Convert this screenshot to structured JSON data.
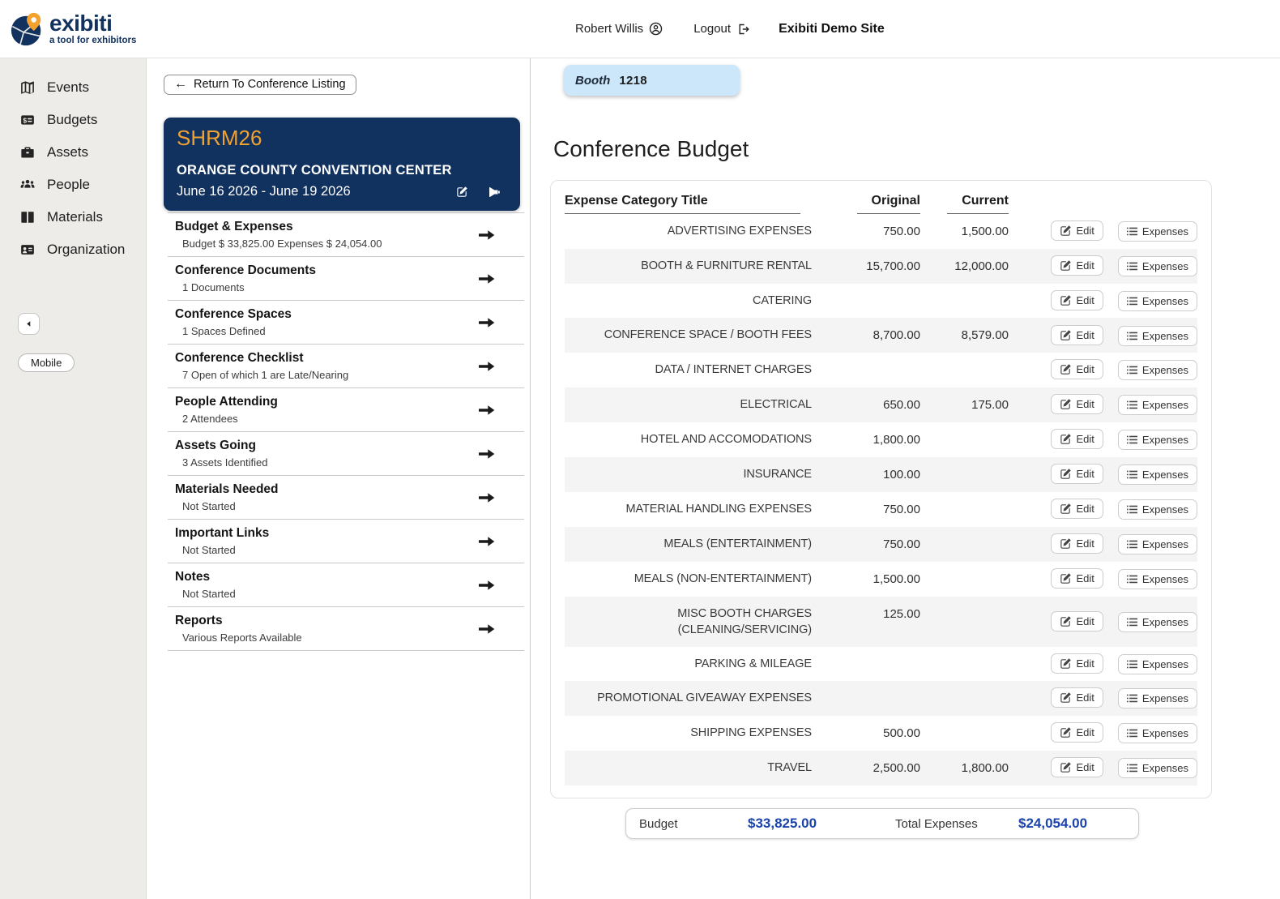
{
  "colors": {
    "navy": "#11315f",
    "orange": "#f0a231",
    "booth": "#cde7fa",
    "money": "#1a43ad",
    "altrow": "#f4f4f4"
  },
  "header": {
    "brand": "exibiti",
    "tagline": "a tool for exhibitors",
    "logo_icon": "logo-globe-icon",
    "user_name": "Robert Willis",
    "user_icon": "person-circle-icon",
    "logout_label": "Logout",
    "logout_icon": "logout-icon",
    "site_name": "Exibiti Demo Site"
  },
  "sidebar": {
    "items": [
      {
        "label": "Events",
        "icon": "map-icon"
      },
      {
        "label": "Budgets",
        "icon": "money-card-icon"
      },
      {
        "label": "Assets",
        "icon": "briefcase-icon"
      },
      {
        "label": "People",
        "icon": "people-icon"
      },
      {
        "label": "Materials",
        "icon": "book-icon"
      },
      {
        "label": "Organization",
        "icon": "id-card-icon"
      }
    ],
    "collapse_icon": "triangle-left-icon",
    "mobile_label": "Mobile"
  },
  "left_panel": {
    "return_button": "Return To Conference Listing",
    "conference": {
      "code": "SHRM26",
      "venue": "ORANGE COUNTY CONVENTION CENTER",
      "dates": "June 16 2026 - June 19 2026",
      "icons": [
        "edit-icon",
        "megaphone-icon"
      ]
    },
    "sections": [
      {
        "title": "Budget & Expenses",
        "subtitle": "Budget $ 33,825.00 Expenses $ 24,054.00"
      },
      {
        "title": "Conference Documents",
        "subtitle": "1 Documents"
      },
      {
        "title": "Conference Spaces",
        "subtitle": "1 Spaces Defined"
      },
      {
        "title": "Conference Checklist",
        "subtitle": "7 Open of which 1 are Late/Nearing"
      },
      {
        "title": "People Attending",
        "subtitle": "2 Attendees"
      },
      {
        "title": "Assets Going",
        "subtitle": "3 Assets Identified"
      },
      {
        "title": "Materials Needed",
        "subtitle": "Not Started"
      },
      {
        "title": "Important Links",
        "subtitle": "Not Started"
      },
      {
        "title": "Notes",
        "subtitle": "Not Started"
      },
      {
        "title": "Reports",
        "subtitle": "Various Reports Available"
      }
    ],
    "section_arrow_icon": "arrow-right-icon"
  },
  "main": {
    "booth_label": "Booth",
    "booth_number": "1218",
    "title": "Conference Budget",
    "table": {
      "headers": [
        "Expense Category Title",
        "Original",
        "Current"
      ],
      "edit_label": "Edit",
      "edit_icon": "edit-icon",
      "expenses_label": "Expenses",
      "expenses_icon": "list-icon",
      "rows": [
        {
          "category": "ADVERTISING EXPENSES",
          "original": "750.00",
          "current": "1,500.00"
        },
        {
          "category": "BOOTH & FURNITURE RENTAL",
          "original": "15,700.00",
          "current": "12,000.00"
        },
        {
          "category": "CATERING",
          "original": "",
          "current": ""
        },
        {
          "category": "CONFERENCE SPACE / BOOTH FEES",
          "original": "8,700.00",
          "current": "8,579.00"
        },
        {
          "category": "DATA / INTERNET CHARGES",
          "original": "",
          "current": ""
        },
        {
          "category": "ELECTRICAL",
          "original": "650.00",
          "current": "175.00"
        },
        {
          "category": "HOTEL AND ACCOMODATIONS",
          "original": "1,800.00",
          "current": ""
        },
        {
          "category": "INSURANCE",
          "original": "100.00",
          "current": ""
        },
        {
          "category": "MATERIAL HANDLING EXPENSES",
          "original": "750.00",
          "current": ""
        },
        {
          "category": "MEALS (ENTERTAINMENT)",
          "original": "750.00",
          "current": ""
        },
        {
          "category": "MEALS (NON-ENTERTAINMENT)",
          "original": "1,500.00",
          "current": ""
        },
        {
          "category": "MISC BOOTH CHARGES (CLEANING/SERVICING)",
          "original": "125.00",
          "current": ""
        },
        {
          "category": "PARKING & MILEAGE",
          "original": "",
          "current": ""
        },
        {
          "category": "PROMOTIONAL GIVEAWAY EXPENSES",
          "original": "",
          "current": ""
        },
        {
          "category": "SHIPPING EXPENSES",
          "original": "500.00",
          "current": ""
        },
        {
          "category": "TRAVEL",
          "original": "2,500.00",
          "current": "1,800.00"
        }
      ]
    },
    "summary": {
      "budget_label": "Budget",
      "budget_value": "$33,825.00",
      "expenses_label": "Total Expenses",
      "expenses_value": "$24,054.00"
    }
  }
}
